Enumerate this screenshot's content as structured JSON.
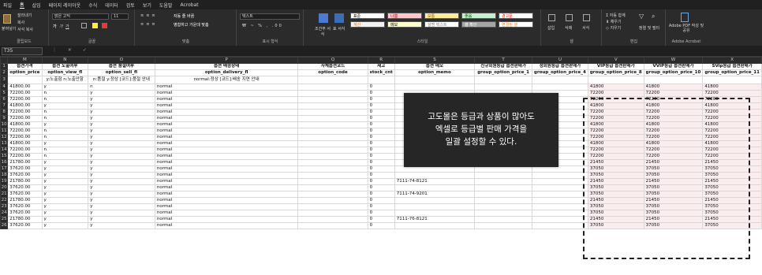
{
  "menu": [
    "파일",
    "홈",
    "삽입",
    "페이지 레이아웃",
    "수식",
    "데이터",
    "검토",
    "보기",
    "도움말",
    "Acrobat"
  ],
  "menu_active_index": 1,
  "ribbon": {
    "clipboard": {
      "paste": "붙여넣기",
      "cut": "잘라내기",
      "copy": "복사",
      "format": "서식 복사",
      "label": "클립보드"
    },
    "font": {
      "name": "맑은 고딕",
      "size": "11",
      "label": "글꼴"
    },
    "align": {
      "wrap": "자동 줄 바꿈",
      "merge": "병합하고 가운데 맞춤",
      "label": "맞춤"
    },
    "number": {
      "format": "텍스트",
      "label": "표시 형식"
    },
    "styles": {
      "cond": "조건부 서식",
      "table": "표 서식",
      "label": "스타일",
      "cells": [
        {
          "t": "표준",
          "bg": "#ffffff",
          "fg": "#000000"
        },
        {
          "t": "나쁨",
          "bg": "#ffc7ce",
          "fg": "#9c0006"
        },
        {
          "t": "보통",
          "bg": "#ffeb9c",
          "fg": "#9c5700"
        },
        {
          "t": "좋음",
          "bg": "#c6efce",
          "fg": "#006100"
        },
        {
          "t": "경고문",
          "bg": "#ffffff",
          "fg": "#ff0000"
        },
        {
          "t": "계산",
          "bg": "#f2f2f2",
          "fg": "#fa7d00"
        },
        {
          "t": "메모",
          "bg": "#ffffcc",
          "fg": "#000000"
        },
        {
          "t": "설명 텍스트",
          "bg": "#ffffff",
          "fg": "#7f7f7f"
        },
        {
          "t": "셀 확인",
          "bg": "#a5a5a5",
          "fg": "#ffffff"
        },
        {
          "t": "연결된 셀",
          "bg": "#ffffff",
          "fg": "#fa7d00"
        }
      ]
    },
    "cells_grp": {
      "insert": "삽입",
      "delete": "삭제",
      "format": "서식",
      "label": "셀"
    },
    "edit": {
      "sum": "자동 합계",
      "fill": "채우기",
      "clear": "지우기",
      "sort": "정렬 및 필터",
      "find": "찾기 및 선택",
      "label": "편집"
    },
    "acrobat": {
      "pdf": "Adobe PDF 작성 및 공유",
      "label": "Adobe Acrobat"
    }
  },
  "formula_bar": {
    "name_box": "T35",
    "fx": "fx",
    "content": ""
  },
  "columns": [
    "M",
    "N",
    "O",
    "P",
    "Q",
    "R",
    "S",
    "T",
    "U",
    "V",
    "W",
    "X"
  ],
  "header_row1": [
    "옵션가격",
    "옵션 노출여부",
    "옵션 품절여부",
    "옵션 배송상태",
    "자체옵션코드",
    "재고",
    "옵션 메모",
    "신규회원등급 옵션판매가",
    "정회원등급 옵션판매가",
    "VIP등급 옵션판매가",
    "VVIP등급 옵션판매가",
    "SVip등급 옵션판매가"
  ],
  "header_row2": [
    "option_price",
    "option_view_fl",
    "option_sell_fl",
    "option_delivery_fl",
    "option_code",
    "stock_cnt",
    "option_memo",
    "group_option_price_1",
    "group_option_price_4",
    "group_option_price_8",
    "group_option_price_10",
    "group_option_price_11"
  ],
  "header_row3": [
    "",
    "y:노출함 n:노출안함",
    "n:품절 y:정상 [코드]:품절 안내",
    "normal:정상 [코드]:배송 지연 안내",
    "",
    "",
    "",
    "",
    "",
    "",
    "",
    ""
  ],
  "rows": [
    [
      "41800.00",
      "y",
      "n",
      "normal",
      "",
      "0",
      "",
      "",
      "",
      "41800",
      "41800",
      "41800"
    ],
    [
      "72200.00",
      "n",
      "y",
      "normal",
      "",
      "0",
      "",
      "",
      "",
      "72200",
      "72200",
      "72200"
    ],
    [
      "72200.00",
      "n",
      "y",
      "normal",
      "",
      "0",
      "",
      "",
      "",
      "72200",
      "72200",
      "72200"
    ],
    [
      "41800.00",
      "y",
      "y",
      "normal",
      "",
      "0",
      "",
      "",
      "",
      "41800",
      "41800",
      "41800"
    ],
    [
      "72200.00",
      "n",
      "y",
      "normal",
      "",
      "0",
      "",
      "",
      "",
      "72200",
      "72200",
      "72200"
    ],
    [
      "72200.00",
      "n",
      "y",
      "normal",
      "",
      "0",
      "",
      "",
      "",
      "72200",
      "72200",
      "72200"
    ],
    [
      "41800.00",
      "y",
      "y",
      "normal",
      "",
      "0",
      "",
      "",
      "",
      "41800",
      "41800",
      "41800"
    ],
    [
      "72200.00",
      "n",
      "y",
      "normal",
      "",
      "0",
      "",
      "",
      "",
      "72200",
      "72200",
      "72200"
    ],
    [
      "72200.00",
      "n",
      "y",
      "normal",
      "",
      "0",
      "",
      "",
      "",
      "72200",
      "72200",
      "72200"
    ],
    [
      "41800.00",
      "y",
      "y",
      "normal",
      "",
      "0",
      "",
      "",
      "",
      "41800",
      "41800",
      "41800"
    ],
    [
      "72200.00",
      "n",
      "y",
      "normal",
      "",
      "0",
      "",
      "",
      "",
      "72200",
      "72200",
      "72200"
    ],
    [
      "72200.00",
      "n",
      "y",
      "normal",
      "",
      "0",
      "",
      "",
      "",
      "72200",
      "72200",
      "72200"
    ],
    [
      "21780.00",
      "y",
      "y",
      "normal",
      "",
      "0",
      "",
      "",
      "",
      "21450",
      "21450",
      "21450"
    ],
    [
      "37620.00",
      "y",
      "y",
      "normal",
      "",
      "0",
      "",
      "",
      "",
      "37050",
      "37050",
      "37050"
    ],
    [
      "37620.00",
      "y",
      "y",
      "normal",
      "",
      "0",
      "",
      "",
      "",
      "37050",
      "37050",
      "37050"
    ],
    [
      "21780.00",
      "y",
      "y",
      "normal",
      "",
      "0",
      "7111-74-8121",
      "",
      "",
      "21450",
      "21450",
      "21450"
    ],
    [
      "37620.00",
      "y",
      "y",
      "normal",
      "",
      "0",
      "",
      "",
      "",
      "37050",
      "37050",
      "37050"
    ],
    [
      "37620.00",
      "y",
      "y",
      "normal",
      "",
      "0",
      "7111-74-9201",
      "",
      "",
      "37050",
      "37050",
      "37050"
    ],
    [
      "21780.00",
      "y",
      "y",
      "normal",
      "",
      "0",
      "",
      "",
      "",
      "21450",
      "21450",
      "21450"
    ],
    [
      "37620.00",
      "y",
      "y",
      "normal",
      "",
      "0",
      "",
      "",
      "",
      "37050",
      "37050",
      "37050"
    ],
    [
      "37620.00",
      "y",
      "y",
      "normal",
      "",
      "0",
      "",
      "",
      "",
      "37050",
      "37050",
      "37050"
    ],
    [
      "21780.00",
      "y",
      "y",
      "normal",
      "",
      "0",
      "7111-76-8121",
      "",
      "",
      "21450",
      "21450",
      "21450"
    ],
    [
      "37620.00",
      "y",
      "y",
      "normal",
      "",
      "0",
      "",
      "",
      "",
      "37050",
      "37050",
      "37050"
    ]
  ],
  "tooltip": {
    "line1": "고도몰은 등급과 상품이 많아도",
    "line2": "엑셀로 등급별 판매 가격을",
    "line3": "일괄 설정할 수 있다."
  }
}
